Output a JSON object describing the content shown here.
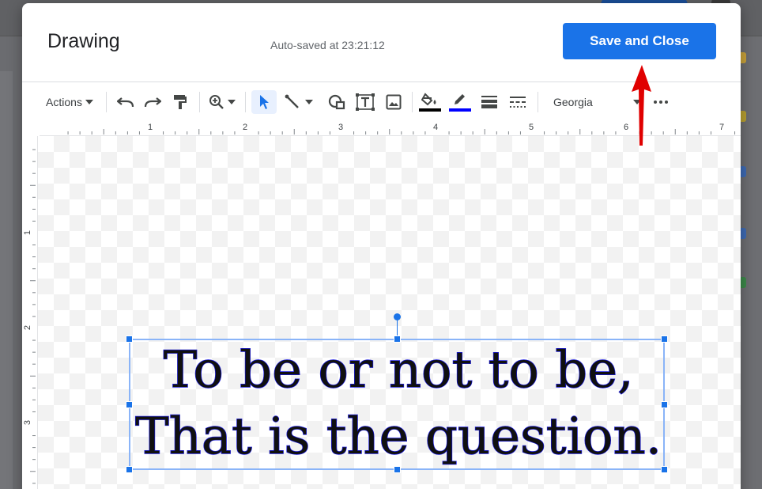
{
  "dialog": {
    "title": "Drawing",
    "autosave_text": "Auto-saved at 23:21:12",
    "save_close_label": "Save and Close"
  },
  "toolbar": {
    "actions_label": "Actions",
    "font_name": "Georgia",
    "fill_color": "#000000",
    "line_color": "#0000ff"
  },
  "ruler": {
    "top_numbers": [
      "1",
      "2",
      "3",
      "4",
      "5",
      "6",
      "7"
    ],
    "left_numbers": [
      "1",
      "2",
      "3"
    ]
  },
  "textbox": {
    "lines": [
      "To be or not to be,",
      "That is the question."
    ]
  },
  "colors": {
    "accent": "#1a73e8",
    "annotation": "#e00000"
  }
}
